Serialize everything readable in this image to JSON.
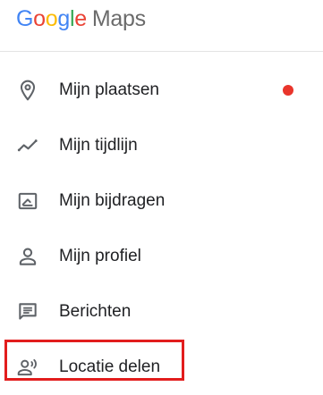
{
  "header": {
    "logo_letters": [
      "G",
      "o",
      "o",
      "g",
      "l",
      "e"
    ],
    "product_name": "Maps",
    "logo_colors": [
      "#4285F4",
      "#EA4335",
      "#FBBC05",
      "#4285F4",
      "#34A853",
      "#EA4335"
    ]
  },
  "menu": {
    "items": [
      {
        "label": "Mijn plaatsen",
        "icon": "location-pin-icon",
        "has_notification": true
      },
      {
        "label": "Mijn tijdlijn",
        "icon": "timeline-icon",
        "has_notification": false
      },
      {
        "label": "Mijn bijdragen",
        "icon": "contributions-icon",
        "has_notification": false
      },
      {
        "label": "Mijn profiel",
        "icon": "person-icon",
        "has_notification": false
      },
      {
        "label": "Berichten",
        "icon": "message-icon",
        "has_notification": false
      },
      {
        "label": "Locatie delen",
        "icon": "location-sharing-icon",
        "has_notification": false
      }
    ]
  },
  "colors": {
    "notification_dot": "#E9352B",
    "highlight_border": "#E21D1D",
    "icon": "#5f6368",
    "text": "#202124"
  },
  "highlighted_item": "Locatie delen"
}
